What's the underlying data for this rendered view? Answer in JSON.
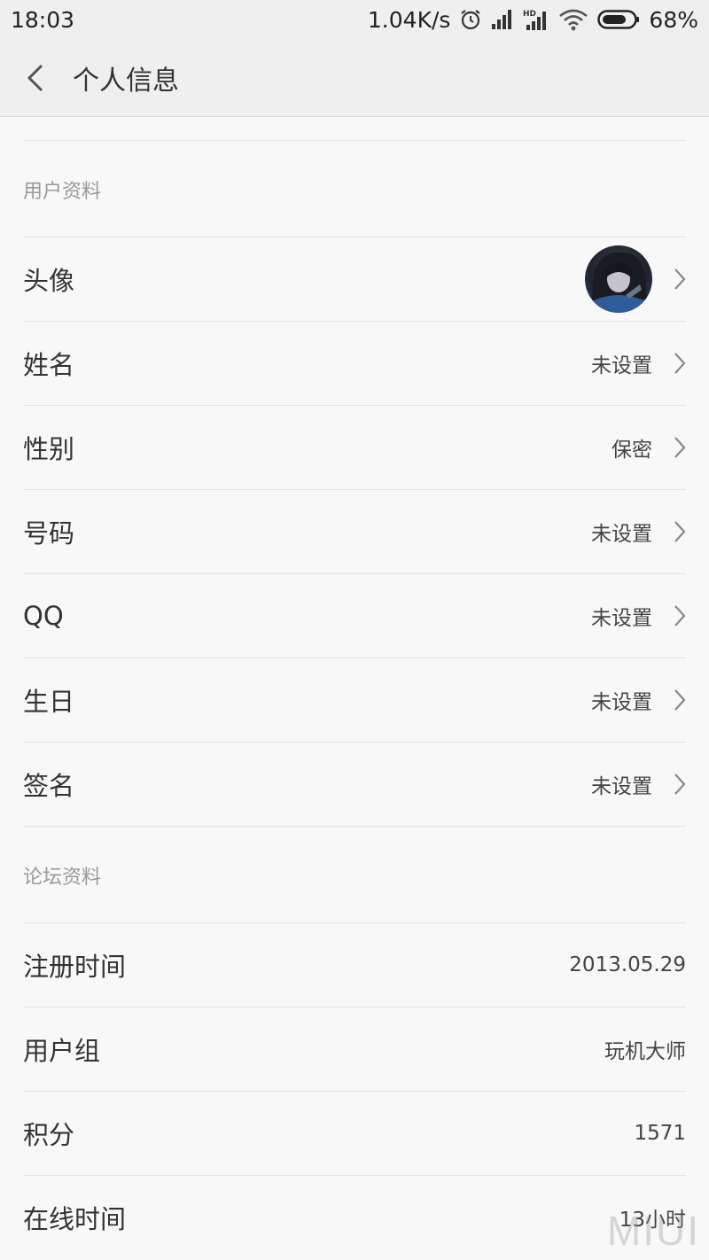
{
  "status_bar": {
    "time": "18:03",
    "net_speed": "1.04K/s",
    "battery": "68%",
    "icons": [
      "alarm-icon",
      "signal-icon",
      "hd-signal-icon",
      "wifi-icon",
      "battery-icon"
    ]
  },
  "header": {
    "title": "个人信息"
  },
  "sections": {
    "user": {
      "title": "用户资料",
      "rows": {
        "avatar": {
          "label": "头像"
        },
        "name": {
          "label": "姓名",
          "value": "未设置"
        },
        "gender": {
          "label": "性别",
          "value": "保密"
        },
        "phone": {
          "label": "号码",
          "value": "未设置"
        },
        "qq": {
          "label": "QQ",
          "value": "未设置"
        },
        "birthday": {
          "label": "生日",
          "value": "未设置"
        },
        "signature": {
          "label": "签名",
          "value": "未设置"
        }
      }
    },
    "forum": {
      "title": "论坛资料",
      "rows": {
        "register_time": {
          "label": "注册时间",
          "value": "2013.05.29"
        },
        "user_group": {
          "label": "用户组",
          "value": "玩机大师"
        },
        "points": {
          "label": "积分",
          "value": "1571"
        },
        "online_time": {
          "label": "在线时间",
          "value": "13小时"
        }
      }
    }
  },
  "watermark": "MIUI"
}
